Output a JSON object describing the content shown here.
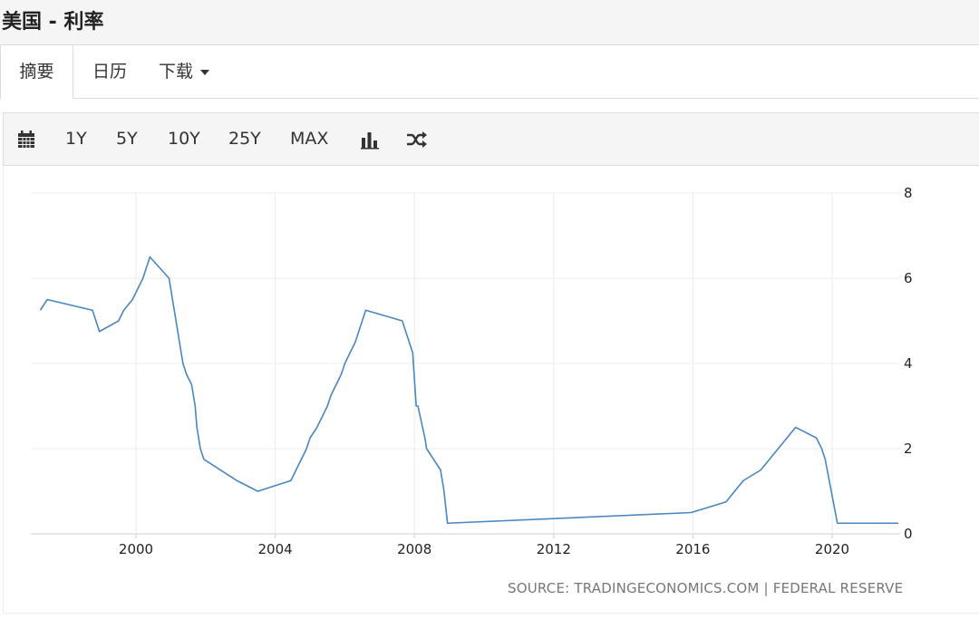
{
  "page": {
    "title": "美国 - 利率"
  },
  "tabs": [
    {
      "label": "摘要",
      "active": true
    },
    {
      "label": "日历",
      "active": false
    },
    {
      "label": "下载",
      "active": false,
      "dropdown": true
    }
  ],
  "toolbar": {
    "ranges": [
      "1Y",
      "5Y",
      "10Y",
      "25Y",
      "MAX"
    ],
    "icons": [
      "calendar-icon",
      "bar-chart-icon",
      "shuffle-icon"
    ]
  },
  "source": "SOURCE: TRADINGECONOMICS.COM | FEDERAL RESERVE",
  "colors": {
    "line": "#4a86c0",
    "grid": "#ececec",
    "toolbar_bg": "#f5f5f5"
  },
  "chart_data": {
    "type": "line",
    "title": "",
    "xlabel": "",
    "ylabel": "",
    "xlim": [
      1997.25,
      2021.9
    ],
    "ylim": [
      0,
      8
    ],
    "x_ticks": [
      2000,
      2004,
      2008,
      2012,
      2016,
      2020
    ],
    "y_ticks": [
      0,
      2,
      4,
      6,
      8
    ],
    "y_axis_position": "right",
    "grid": true,
    "step": true,
    "series": [
      {
        "values": [
          [
            1997.25,
            5.25
          ],
          [
            1997.45,
            5.5
          ],
          [
            1998.75,
            5.25
          ],
          [
            1998.85,
            5.0
          ],
          [
            1998.95,
            4.75
          ],
          [
            1999.5,
            5.0
          ],
          [
            1999.65,
            5.25
          ],
          [
            1999.9,
            5.5
          ],
          [
            2000.05,
            5.75
          ],
          [
            2000.2,
            6.0
          ],
          [
            2000.4,
            6.5
          ],
          [
            2000.95,
            6.0
          ],
          [
            2001.05,
            5.5
          ],
          [
            2001.15,
            5.0
          ],
          [
            2001.25,
            4.5
          ],
          [
            2001.35,
            4.0
          ],
          [
            2001.45,
            3.75
          ],
          [
            2001.6,
            3.5
          ],
          [
            2001.7,
            3.0
          ],
          [
            2001.75,
            2.5
          ],
          [
            2001.85,
            2.0
          ],
          [
            2001.95,
            1.75
          ],
          [
            2002.9,
            1.25
          ],
          [
            2003.5,
            1.0
          ],
          [
            2004.45,
            1.25
          ],
          [
            2004.6,
            1.5
          ],
          [
            2004.75,
            1.75
          ],
          [
            2004.9,
            2.0
          ],
          [
            2005.0,
            2.25
          ],
          [
            2005.2,
            2.5
          ],
          [
            2005.35,
            2.75
          ],
          [
            2005.5,
            3.0
          ],
          [
            2005.6,
            3.25
          ],
          [
            2005.75,
            3.5
          ],
          [
            2005.9,
            3.75
          ],
          [
            2006.0,
            4.0
          ],
          [
            2006.15,
            4.25
          ],
          [
            2006.3,
            4.5
          ],
          [
            2006.4,
            4.75
          ],
          [
            2006.5,
            5.0
          ],
          [
            2006.6,
            5.25
          ],
          [
            2007.65,
            5.0
          ],
          [
            2007.75,
            4.75
          ],
          [
            2007.85,
            4.5
          ],
          [
            2007.95,
            4.25
          ],
          [
            2008.05,
            3.0
          ],
          [
            2008.1,
            3.0
          ],
          [
            2008.3,
            2.25
          ],
          [
            2008.35,
            2.0
          ],
          [
            2008.75,
            1.5
          ],
          [
            2008.85,
            1.0
          ],
          [
            2008.95,
            0.25
          ],
          [
            2015.95,
            0.5
          ],
          [
            2016.95,
            0.75
          ],
          [
            2017.2,
            1.0
          ],
          [
            2017.45,
            1.25
          ],
          [
            2017.95,
            1.5
          ],
          [
            2018.2,
            1.75
          ],
          [
            2018.45,
            2.0
          ],
          [
            2018.7,
            2.25
          ],
          [
            2018.95,
            2.5
          ],
          [
            2019.55,
            2.25
          ],
          [
            2019.7,
            2.0
          ],
          [
            2019.8,
            1.75
          ],
          [
            2020.15,
            0.25
          ],
          [
            2021.9,
            0.25
          ]
        ]
      }
    ]
  }
}
